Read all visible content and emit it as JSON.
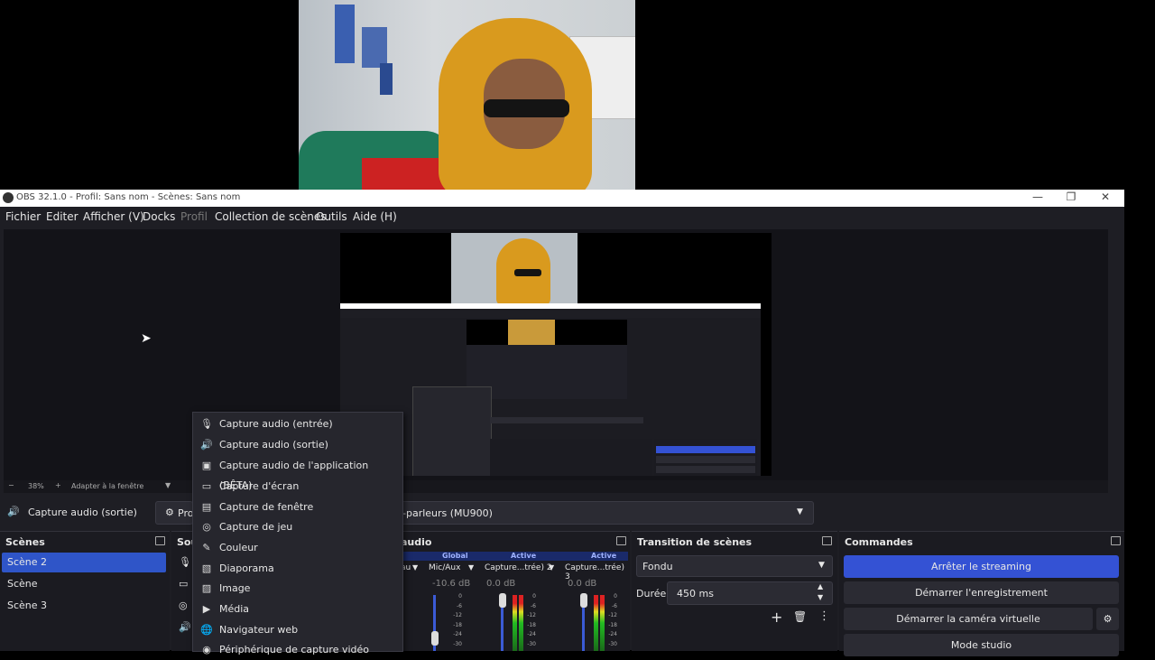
{
  "window": {
    "title": "OBS 32.1.0 - Profil: Sans nom - Scènes: Sans nom",
    "minimize": "—",
    "maximize": "❐",
    "close": "✕"
  },
  "menu": [
    "Fichier",
    "Editer",
    "Afficher (V)",
    "Docks",
    "Profil",
    "Collection de scènes",
    "Outils",
    "Aide (H)"
  ],
  "zoom": {
    "minus": "−",
    "level": "38%",
    "plus": "+",
    "fit": "Adapter à la fenêtre"
  },
  "source_bar": {
    "selected_source": "Capture audio (sortie)",
    "properties_label": "Pro",
    "device_value": "-parleurs (MU900)"
  },
  "scenes": {
    "title": "Scènes",
    "items": [
      "Scène 2",
      "Scène",
      "Scène 3"
    ],
    "selected": "Scène 2"
  },
  "sources": {
    "title": "Sou"
  },
  "audio": {
    "title": "audio",
    "global": "Global",
    "active": "Active",
    "channels": [
      {
        "name": "au",
        "db": ""
      },
      {
        "name": "Mic/Aux",
        "db": "-10.6 dB"
      },
      {
        "name": "Capture...trée) 2",
        "db": "0.0 dB"
      },
      {
        "name": "Capture...trée) 3",
        "db": "0.0 dB"
      }
    ],
    "scale": [
      "0",
      "-6",
      "-12",
      "-18",
      "-24",
      "-30"
    ]
  },
  "transition": {
    "title": "Transition de scènes",
    "type": "Fondu",
    "duration_label": "Durée",
    "duration_value": "450 ms"
  },
  "controls": {
    "title": "Commandes",
    "stop_streaming": "Arrêter le streaming",
    "start_recording": "Démarrer l'enregistrement",
    "start_virtualcam": "Démarrer la caméra virtuelle",
    "studio_mode": "Mode studio"
  },
  "context_menu": {
    "items": [
      {
        "label": "Capture audio (entrée)",
        "icon": "microphone-icon",
        "glyph": "🎙"
      },
      {
        "label": "Capture audio (sortie)",
        "icon": "speaker-icon",
        "glyph": "🔊"
      },
      {
        "label": "Capture audio de l'application (BÊTA)",
        "icon": "app-audio-icon",
        "glyph": "▣"
      },
      {
        "label": "Capture d'écran",
        "icon": "monitor-icon",
        "glyph": "▭"
      },
      {
        "label": "Capture de fenêtre",
        "icon": "window-icon",
        "glyph": "▤"
      },
      {
        "label": "Capture de jeu",
        "icon": "gamepad-icon",
        "glyph": "◎"
      },
      {
        "label": "Couleur",
        "icon": "brush-icon",
        "glyph": "✎"
      },
      {
        "label": "Diaporama",
        "icon": "slideshow-icon",
        "glyph": "▧"
      },
      {
        "label": "Image",
        "icon": "image-icon",
        "glyph": "▨"
      },
      {
        "label": "Média",
        "icon": "play-icon",
        "glyph": "▶"
      },
      {
        "label": "Navigateur web",
        "icon": "globe-icon",
        "glyph": "🌐"
      },
      {
        "label": "Périphérique de capture vidéo",
        "icon": "camera-icon",
        "glyph": "◉"
      }
    ]
  },
  "colors": {
    "accent": "#3452d4",
    "bg": "#1e1e24",
    "dock": "#1b1b21"
  }
}
